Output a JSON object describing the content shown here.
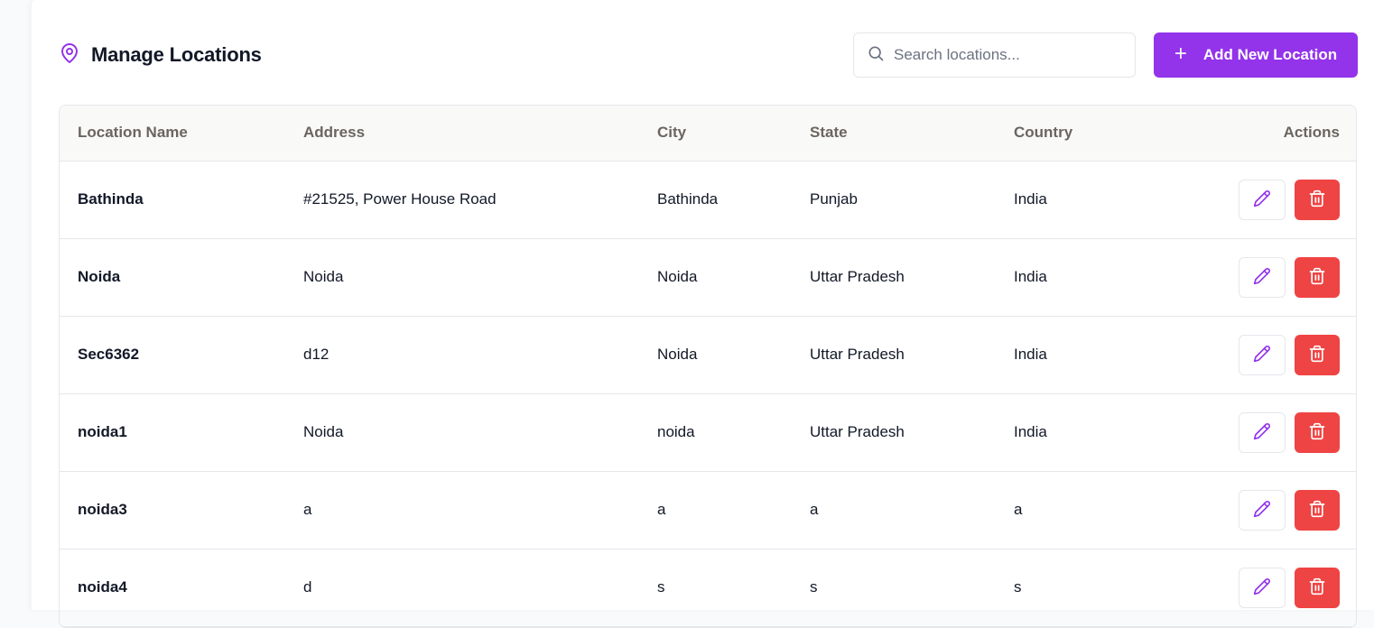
{
  "header": {
    "title": "Manage Locations",
    "icon": "map-pin-icon",
    "search_placeholder": "Search locations...",
    "add_button_label": "Add New Location",
    "accent_color": "#9333ea"
  },
  "table": {
    "columns": [
      "Location Name",
      "Address",
      "City",
      "State",
      "Country",
      "Actions"
    ],
    "rows": [
      {
        "name": "Bathinda",
        "address": "#21525, Power House Road",
        "city": "Bathinda",
        "state": "Punjab",
        "country": "India"
      },
      {
        "name": "Noida",
        "address": "Noida",
        "city": "Noida",
        "state": "Uttar Pradesh",
        "country": "India"
      },
      {
        "name": "Sec6362",
        "address": "d12",
        "city": "Noida",
        "state": "Uttar Pradesh",
        "country": "India"
      },
      {
        "name": "noida1",
        "address": "Noida",
        "city": "noida",
        "state": "Uttar Pradesh",
        "country": "India"
      },
      {
        "name": "noida3",
        "address": "a",
        "city": "a",
        "state": "a",
        "country": "a"
      },
      {
        "name": "noida4",
        "address": "d",
        "city": "s",
        "state": "s",
        "country": "s"
      }
    ],
    "row_actions": {
      "edit_icon": "pencil-icon",
      "delete_icon": "trash-icon",
      "delete_color": "#ef4444"
    }
  }
}
